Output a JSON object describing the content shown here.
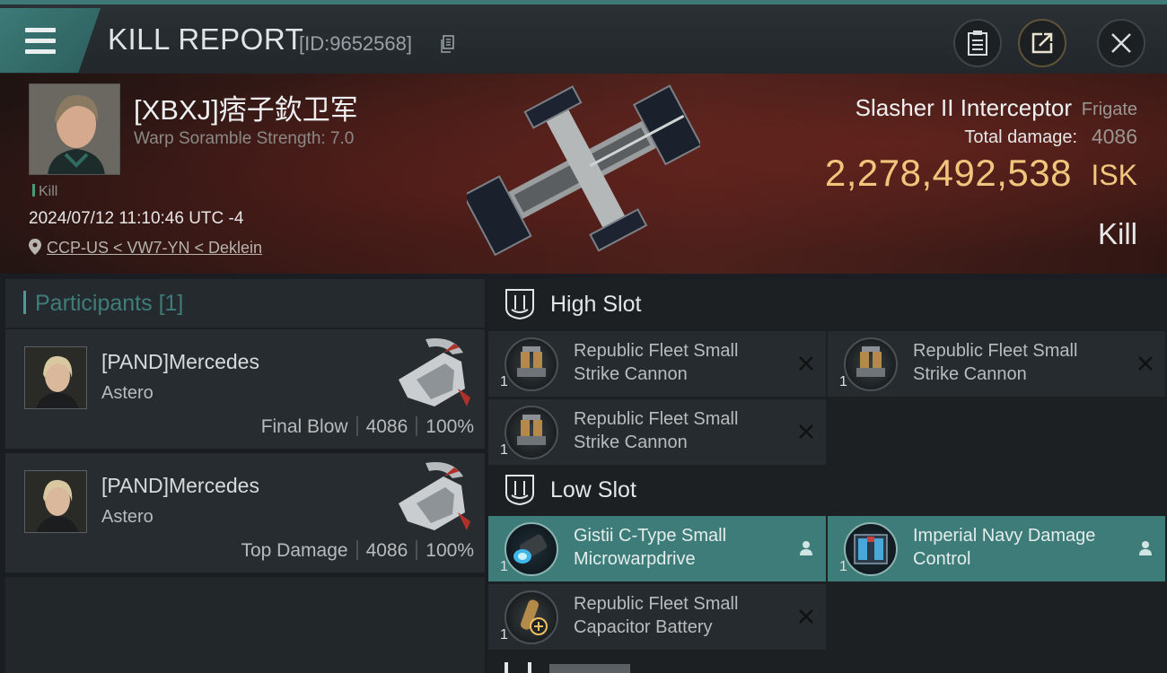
{
  "header": {
    "title": "KILL REPORT",
    "kill_id": "[ID:9652568]"
  },
  "victim": {
    "name": "[XBXJ]痞子欽卫军",
    "warp_scramble": "Warp Soramble Strength: 7.0",
    "tag": "Kill",
    "datetime": "2024/07/12 11:10:46 UTC -4",
    "location": "CCP-US < VW7-YN < Deklein"
  },
  "ship": {
    "name": "Slasher II Interceptor",
    "class": "Frigate",
    "total_damage_label": "Total damage:",
    "total_damage_value": "4086",
    "isk_value": "2,278,492,538",
    "isk_unit": "ISK",
    "result": "Kill"
  },
  "participants": {
    "label": "Participants",
    "count": "[1]",
    "items": [
      {
        "name": "[PAND]Mercedes",
        "ship": "Astero",
        "role": "Final Blow",
        "damage": "4086",
        "percent": "100%"
      },
      {
        "name": "[PAND]Mercedes",
        "ship": "Astero",
        "role": "Top Damage",
        "damage": "4086",
        "percent": "100%"
      }
    ]
  },
  "slots": {
    "high": {
      "label": "High Slot",
      "modules": [
        {
          "name": "Republic Fleet Small Strike Cannon",
          "qty": "1",
          "status": "destroyed"
        },
        {
          "name": "Republic Fleet Small Strike Cannon",
          "qty": "1",
          "status": "destroyed"
        },
        {
          "name": "Republic Fleet Small Strike Cannon",
          "qty": "1",
          "status": "destroyed"
        }
      ]
    },
    "low": {
      "label": "Low Slot",
      "modules": [
        {
          "name": "Gistii C-Type Small Microwarpdrive",
          "qty": "1",
          "status": "dropped"
        },
        {
          "name": "Imperial Navy Damage Control",
          "qty": "1",
          "status": "dropped"
        },
        {
          "name": "Republic Fleet Small Capacitor Battery",
          "qty": "1",
          "status": "destroyed"
        }
      ]
    }
  },
  "colors": {
    "accent_teal": "#3d7c78",
    "isk_gold": "#f1c67c"
  }
}
